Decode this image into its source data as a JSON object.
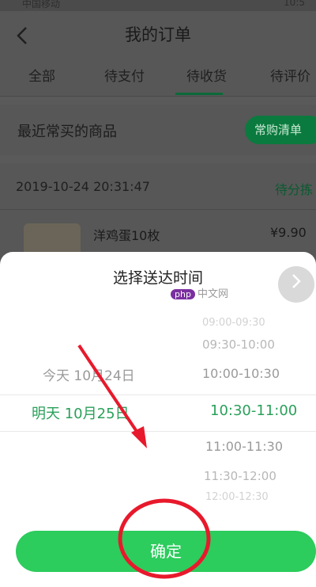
{
  "status_bar": {
    "left": "中国移动",
    "right": "10:5"
  },
  "nav": {
    "title": "我的订单"
  },
  "tabs": [
    {
      "label": "全部"
    },
    {
      "label": "待支付"
    },
    {
      "label": "待收货"
    },
    {
      "label": "待评价"
    }
  ],
  "recent": {
    "label": "最近常买的商品",
    "button_label": "常购清单"
  },
  "order": {
    "time": "2019-10-24 20:31:47",
    "status": "待分拣",
    "item_name": "洋鸡蛋10枚",
    "item_price": "¥9.90"
  },
  "sheet": {
    "title": "选择送达时间",
    "watermark": "中文网",
    "watermark_badge": "php",
    "days": [
      {
        "label": "今天 10月24日"
      },
      {
        "label": "明天 10月25日"
      }
    ],
    "slots": [
      {
        "label": "09:00-09:30"
      },
      {
        "label": "09:30-10:00"
      },
      {
        "label": "10:00-10:30"
      },
      {
        "label": "10:30-11:00"
      },
      {
        "label": "11:00-11:30"
      },
      {
        "label": "11:30-12:00"
      },
      {
        "label": "12:00-12:30"
      }
    ],
    "confirm_label": "确定"
  },
  "colors": {
    "accent": "#2ccc5d",
    "selected_text": "#2aa05a",
    "annotation": "#e8192c"
  }
}
